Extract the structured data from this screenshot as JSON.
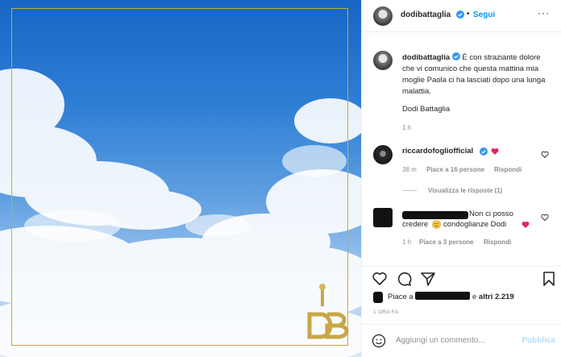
{
  "post": {
    "author": "dodibattaglia",
    "follow_label": "Segui",
    "dot": "•",
    "more": "···"
  },
  "caption": {
    "username": "dodibattaglia",
    "text": "È con straziante dolore che vi comunico che questa mattina mia moglie Paola ci ha lasciati dopo una lunga malattia.",
    "signature": "Dodi Battaglia",
    "time": "1 h"
  },
  "comments": [
    {
      "username": "riccardofogliofficial",
      "time": "38 m",
      "likes": "Piace a 16 persone",
      "reply": "Rispondi",
      "view_replies": "Visualizza le risposte (1)"
    },
    {
      "text_start": "Non ci posso",
      "text_line2_a": "credere",
      "text_line2_b": "condoglianze Dodi",
      "time": "1 h",
      "likes": "Piace a 3 persone",
      "reply": "Rispondi"
    }
  ],
  "likes": {
    "prefix": "Piace a",
    "suffix_connector": "e",
    "others": "altri 2.219"
  },
  "time_ago": "1 ORA FA",
  "add_comment": {
    "placeholder": "Aggiungi un commento...",
    "publish": "Pubblica"
  },
  "colors": {
    "accent": "#0095f6",
    "heart": "#ed4956",
    "frame_gold": "#c9a646"
  }
}
